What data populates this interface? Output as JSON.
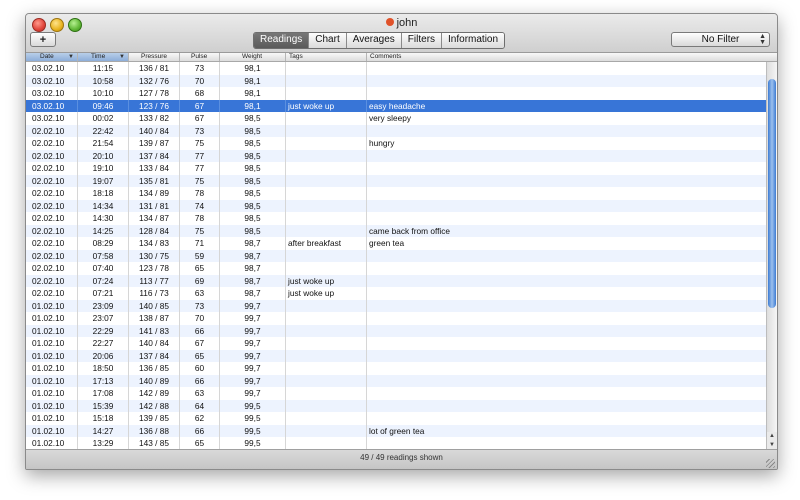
{
  "window": {
    "title": "john"
  },
  "toolbar": {
    "add_label": "+",
    "tabs": [
      {
        "label": "Readings",
        "active": true
      },
      {
        "label": "Chart",
        "active": false
      },
      {
        "label": "Averages",
        "active": false
      },
      {
        "label": "Filters",
        "active": false
      },
      {
        "label": "Information",
        "active": false
      }
    ],
    "filter_value": "No Filter"
  },
  "table": {
    "columns": [
      "Date",
      "Time",
      "Pressure",
      "Pulse",
      "Weight",
      "Tags",
      "Comments"
    ],
    "rows": [
      {
        "date": "03.02.10",
        "time": "11:15",
        "pressure": "136 /  81",
        "pulse": "73",
        "weight": "98,1",
        "tags": "",
        "comments": ""
      },
      {
        "date": "03.02.10",
        "time": "10:58",
        "pressure": "132 /  76",
        "pulse": "70",
        "weight": "98,1",
        "tags": "",
        "comments": ""
      },
      {
        "date": "03.02.10",
        "time": "10:10",
        "pressure": "127 /  78",
        "pulse": "68",
        "weight": "98,1",
        "tags": "",
        "comments": ""
      },
      {
        "date": "03.02.10",
        "time": "09:46",
        "pressure": "123 /  76",
        "pulse": "67",
        "weight": "98,1",
        "tags": "just woke up",
        "comments": "easy headache",
        "selected": true
      },
      {
        "date": "03.02.10",
        "time": "00:02",
        "pressure": "133 /  82",
        "pulse": "67",
        "weight": "98,5",
        "tags": "",
        "comments": "very sleepy"
      },
      {
        "date": "02.02.10",
        "time": "22:42",
        "pressure": "140 /  84",
        "pulse": "73",
        "weight": "98,5",
        "tags": "",
        "comments": ""
      },
      {
        "date": "02.02.10",
        "time": "21:54",
        "pressure": "139 /  87",
        "pulse": "75",
        "weight": "98,5",
        "tags": "",
        "comments": "hungry"
      },
      {
        "date": "02.02.10",
        "time": "20:10",
        "pressure": "137 /  84",
        "pulse": "77",
        "weight": "98,5",
        "tags": "",
        "comments": ""
      },
      {
        "date": "02.02.10",
        "time": "19:10",
        "pressure": "133 /  84",
        "pulse": "77",
        "weight": "98,5",
        "tags": "",
        "comments": ""
      },
      {
        "date": "02.02.10",
        "time": "19:07",
        "pressure": "135 /  81",
        "pulse": "75",
        "weight": "98,5",
        "tags": "",
        "comments": ""
      },
      {
        "date": "02.02.10",
        "time": "18:18",
        "pressure": "134 /  89",
        "pulse": "78",
        "weight": "98,5",
        "tags": "",
        "comments": ""
      },
      {
        "date": "02.02.10",
        "time": "14:34",
        "pressure": "131 /  81",
        "pulse": "74",
        "weight": "98,5",
        "tags": "",
        "comments": ""
      },
      {
        "date": "02.02.10",
        "time": "14:30",
        "pressure": "134 /  87",
        "pulse": "78",
        "weight": "98,5",
        "tags": "",
        "comments": ""
      },
      {
        "date": "02.02.10",
        "time": "14:25",
        "pressure": "128 /  84",
        "pulse": "75",
        "weight": "98,5",
        "tags": "",
        "comments": "came back from office"
      },
      {
        "date": "02.02.10",
        "time": "08:29",
        "pressure": "134 /  83",
        "pulse": "71",
        "weight": "98,7",
        "tags": "after breakfast",
        "comments": "green tea"
      },
      {
        "date": "02.02.10",
        "time": "07:58",
        "pressure": "130 /  75",
        "pulse": "59",
        "weight": "98,7",
        "tags": "",
        "comments": ""
      },
      {
        "date": "02.02.10",
        "time": "07:40",
        "pressure": "123 /  78",
        "pulse": "65",
        "weight": "98,7",
        "tags": "",
        "comments": ""
      },
      {
        "date": "02.02.10",
        "time": "07:24",
        "pressure": "113 /  77",
        "pulse": "69",
        "weight": "98,7",
        "tags": "just woke up",
        "comments": ""
      },
      {
        "date": "02.02.10",
        "time": "07:21",
        "pressure": "116 /  73",
        "pulse": "63",
        "weight": "98,7",
        "tags": "just woke up",
        "comments": ""
      },
      {
        "date": "01.02.10",
        "time": "23:09",
        "pressure": "140 /  85",
        "pulse": "73",
        "weight": "99,7",
        "tags": "",
        "comments": ""
      },
      {
        "date": "01.02.10",
        "time": "23:07",
        "pressure": "138 /  87",
        "pulse": "70",
        "weight": "99,7",
        "tags": "",
        "comments": ""
      },
      {
        "date": "01.02.10",
        "time": "22:29",
        "pressure": "141 /  83",
        "pulse": "66",
        "weight": "99,7",
        "tags": "",
        "comments": ""
      },
      {
        "date": "01.02.10",
        "time": "22:27",
        "pressure": "140 /  84",
        "pulse": "67",
        "weight": "99,7",
        "tags": "",
        "comments": ""
      },
      {
        "date": "01.02.10",
        "time": "20:06",
        "pressure": "137 /  84",
        "pulse": "65",
        "weight": "99,7",
        "tags": "",
        "comments": ""
      },
      {
        "date": "01.02.10",
        "time": "18:50",
        "pressure": "136 /  85",
        "pulse": "60",
        "weight": "99,7",
        "tags": "",
        "comments": ""
      },
      {
        "date": "01.02.10",
        "time": "17:13",
        "pressure": "140 /  89",
        "pulse": "66",
        "weight": "99,7",
        "tags": "",
        "comments": ""
      },
      {
        "date": "01.02.10",
        "time": "17:08",
        "pressure": "142 /  89",
        "pulse": "63",
        "weight": "99,7",
        "tags": "",
        "comments": ""
      },
      {
        "date": "01.02.10",
        "time": "15:39",
        "pressure": "142 /  88",
        "pulse": "64",
        "weight": "99,5",
        "tags": "",
        "comments": ""
      },
      {
        "date": "01.02.10",
        "time": "15:18",
        "pressure": "139 /  85",
        "pulse": "62",
        "weight": "99,5",
        "tags": "",
        "comments": ""
      },
      {
        "date": "01.02.10",
        "time": "14:27",
        "pressure": "136 /  88",
        "pulse": "66",
        "weight": "99,5",
        "tags": "",
        "comments": "lot of green tea"
      },
      {
        "date": "01.02.10",
        "time": "13:29",
        "pressure": "143 /  85",
        "pulse": "65",
        "weight": "99,5",
        "tags": "",
        "comments": ""
      }
    ]
  },
  "status": {
    "text": "49 / 49 readings shown"
  }
}
